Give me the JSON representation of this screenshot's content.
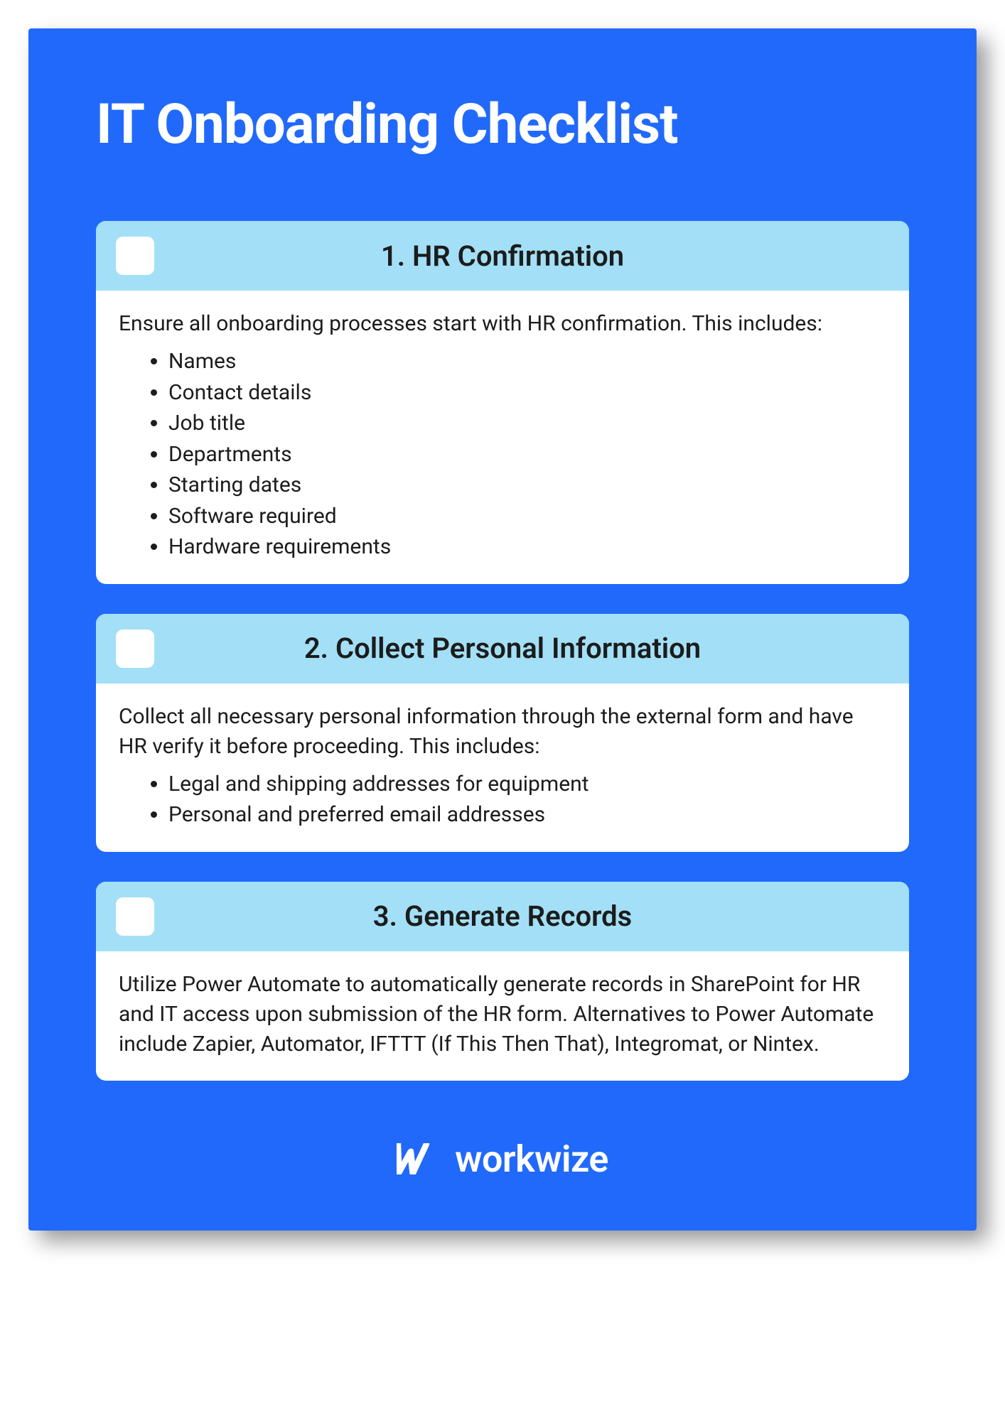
{
  "title": "IT Onboarding Checklist",
  "colors": {
    "page_bg": "#2169fb",
    "card_header_bg": "#a3e0f7",
    "card_bg": "#ffffff",
    "text": "#1c1c1c"
  },
  "sections": [
    {
      "heading": "1. HR Confirmation",
      "intro": "Ensure all onboarding processes start with HR confirmation. This includes:",
      "bullets": [
        "Names",
        "Contact details",
        "Job title",
        "Departments",
        "Starting dates",
        "Software required",
        "Hardware requirements"
      ]
    },
    {
      "heading": "2. Collect Personal Information",
      "intro": "Collect all necessary personal information through the external form and have HR verify it before proceeding. This includes:",
      "bullets": [
        "Legal and shipping addresses for equipment",
        "Personal and preferred email addresses"
      ]
    },
    {
      "heading": "3. Generate Records",
      "body": "Utilize Power Automate to automatically generate records in SharePoint for HR and IT access upon submission of the HR form. Alternatives to Power Automate include Zapier, Automator, IFTTT (If This Then That), Integromat, or Nintex."
    }
  ],
  "brand": {
    "name": "workwize"
  }
}
